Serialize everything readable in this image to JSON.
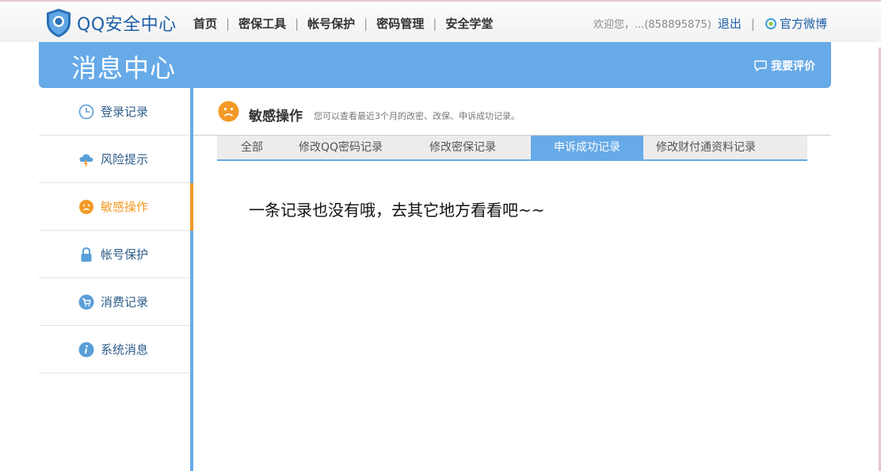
{
  "brand": {
    "logo_text": "QQ安全中心"
  },
  "nav": [
    {
      "label": "首页"
    },
    {
      "label": "密保工具"
    },
    {
      "label": "帐号保护"
    },
    {
      "label": "密码管理"
    },
    {
      "label": "安全学堂"
    }
  ],
  "user": {
    "welcome": "欢迎您，...(858895875)",
    "logout": "退出",
    "weibo": "官方微博"
  },
  "banner": {
    "title": "消息中心",
    "rate": "我要评价"
  },
  "sidebar": {
    "items": [
      {
        "label": "登录记录",
        "icon": "clock-icon"
      },
      {
        "label": "风险提示",
        "icon": "storm-cloud-icon"
      },
      {
        "label": "敏感操作",
        "icon": "face-icon"
      },
      {
        "label": "帐号保护",
        "icon": "lock-icon"
      },
      {
        "label": "消费记录",
        "icon": "cart-icon"
      },
      {
        "label": "系统消息",
        "icon": "info-icon"
      }
    ],
    "active_index": 2
  },
  "section": {
    "title": "敏感操作",
    "description": "您可以查看最近3个月的改密、改保、申诉成功记录。"
  },
  "tabs": [
    {
      "label": "全部"
    },
    {
      "label": "修改QQ密码记录"
    },
    {
      "label": "修改密保记录"
    },
    {
      "label": "申诉成功记录"
    },
    {
      "label": "修改财付通资料记录"
    }
  ],
  "active_tab": 3,
  "empty_message": "一条记录也没有哦，去其它地方看看吧~~",
  "colors": {
    "accent": "#67aae8",
    "active": "#f39a27",
    "link": "#1d5fa8"
  }
}
